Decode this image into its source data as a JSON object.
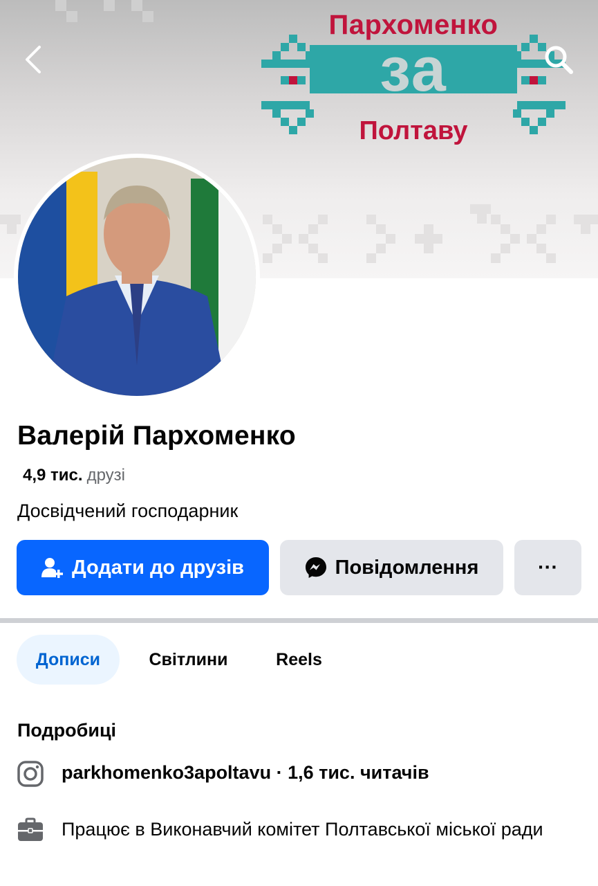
{
  "cover": {
    "banner_top": "Пархоменко",
    "banner_middle": "за",
    "banner_bottom": "Полтаву",
    "colors": {
      "teal": "#2ea7a7",
      "crimson": "#c0143c"
    }
  },
  "nav": {
    "back_icon": "chevron-left-icon",
    "search_icon": "search-icon"
  },
  "profile": {
    "name": "Валерій Пархоменко",
    "friends_count": "4,9 тис.",
    "friends_label": "друзі",
    "bio": "Досвідчений господарник"
  },
  "actions": {
    "add_friend": "Додати до друзів",
    "message": "Повідомлення",
    "more": "···"
  },
  "tabs": [
    {
      "label": "Дописи",
      "active": true
    },
    {
      "label": "Світлини",
      "active": false
    },
    {
      "label": "Reels",
      "active": false
    }
  ],
  "details": {
    "title": "Подробиці",
    "instagram": "parkhomenko3apoltavu · 1,6 тис. читачів",
    "work": "Працює в Виконавчий комітет Полтавської міської ради"
  },
  "theme": {
    "primary": "#0866ff",
    "secondary_bg": "#e4e6eb",
    "active_tab_bg": "#ebf5ff",
    "active_tab_text": "#0064d1"
  }
}
